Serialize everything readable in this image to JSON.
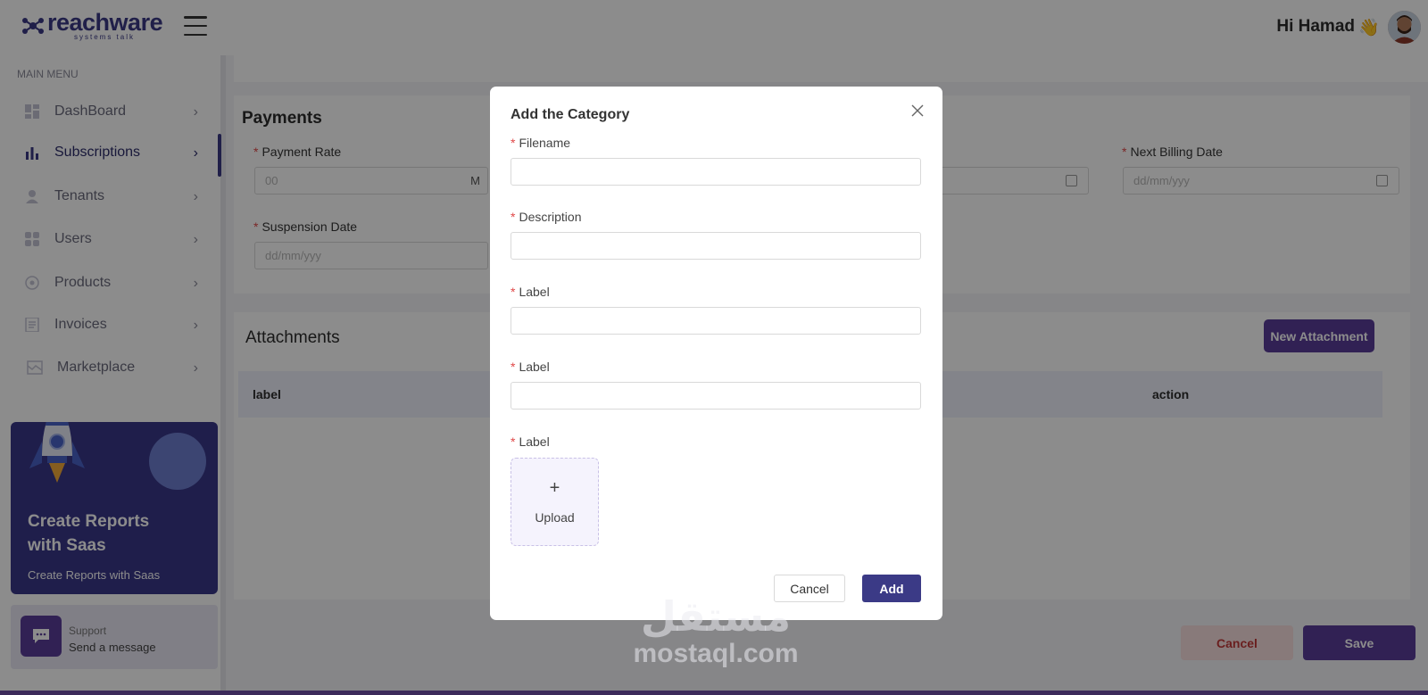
{
  "header": {
    "logo_word": "reachware",
    "logo_tagline": "systems talk",
    "greeting": "Hi Hamad",
    "wave_emoji": "👋"
  },
  "sidebar": {
    "menu_title": "MAIN MENU",
    "items": [
      {
        "label": "DashBoard",
        "icon": "dashboard-icon"
      },
      {
        "label": "Subscriptions",
        "icon": "bar-chart-icon",
        "active": true
      },
      {
        "label": "Tenants",
        "icon": "user-icon"
      },
      {
        "label": "Users",
        "icon": "users-grid-icon"
      },
      {
        "label": "Products",
        "icon": "product-icon"
      },
      {
        "label": "Invoices",
        "icon": "invoice-icon"
      },
      {
        "label": "Marketplace",
        "icon": "marketplace-icon"
      }
    ],
    "promo": {
      "title": "Create Reports with Saas",
      "subtitle": "Create Reports with Saas"
    },
    "support": {
      "title": "Support",
      "subtitle": "Send a message"
    }
  },
  "payments": {
    "title": "Payments",
    "payment_rate_label": "Payment Rate",
    "payment_rate_placeholder": "00",
    "payment_rate_suffix": "M",
    "next_billing_label": "Next Billing Date",
    "next_billing_placeholder": "dd/mm/yyy",
    "suspension_label": "Suspension Date",
    "suspension_placeholder": "dd/mm/yyy"
  },
  "attachments": {
    "title": "Attachments",
    "new_button": "New Attachment",
    "columns": [
      "label",
      "action"
    ]
  },
  "footer": {
    "cancel": "Cancel",
    "save": "Save"
  },
  "modal": {
    "title": "Add the Category",
    "fields": [
      {
        "label": "Filename",
        "value": ""
      },
      {
        "label": "Description",
        "value": ""
      },
      {
        "label": "Label",
        "value": ""
      },
      {
        "label": "Label",
        "value": ""
      }
    ],
    "upload_label": "Label",
    "upload_text": "Upload",
    "upload_plus": "+",
    "cancel": "Cancel",
    "add": "Add"
  },
  "watermark": {
    "arabic": "مستقل",
    "latin": "mostaql.com"
  },
  "colors": {
    "brand": "#3b3a86",
    "accent": "#5a3d99",
    "danger": "#e04848"
  }
}
